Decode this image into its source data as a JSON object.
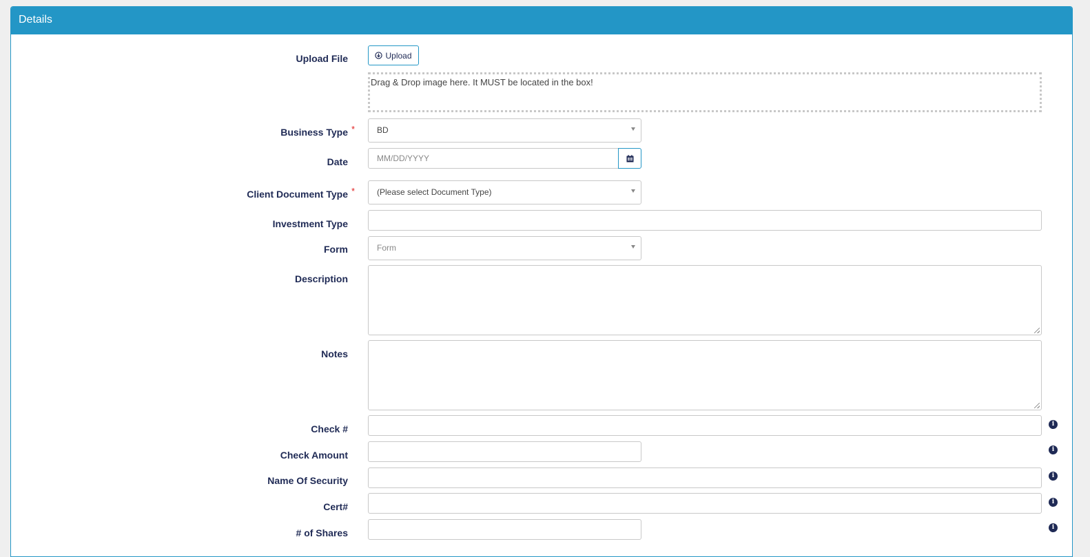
{
  "panel": {
    "title": "Details"
  },
  "upload": {
    "label": "Upload File",
    "button_label": "Upload",
    "dropzone_text": "Drag & Drop image here. It MUST be located in the box!"
  },
  "business_type": {
    "label": "Business Type",
    "required_mark": "*",
    "value": "BD"
  },
  "date": {
    "label": "Date",
    "placeholder": "MM/DD/YYYY"
  },
  "client_document_type": {
    "label": "Client Document Type",
    "required_mark": "*",
    "value": "(Please select Document Type)"
  },
  "investment_type": {
    "label": "Investment Type",
    "value": ""
  },
  "form": {
    "label": "Form",
    "placeholder": "Form"
  },
  "description": {
    "label": "Description",
    "value": ""
  },
  "notes": {
    "label": "Notes",
    "value": ""
  },
  "check_number": {
    "label": "Check #",
    "value": ""
  },
  "check_amount": {
    "label": "Check Amount",
    "value": ""
  },
  "name_of_security": {
    "label": "Name Of Security",
    "value": ""
  },
  "cert_number": {
    "label": "Cert#",
    "value": ""
  },
  "num_shares": {
    "label": "# of Shares",
    "value": ""
  },
  "icons": {
    "upload": "download-circle-icon",
    "calendar": "calendar-icon",
    "info": "info-icon",
    "info_glyph": "i"
  },
  "colors": {
    "header": "#2396c6",
    "label": "#1f2a55",
    "required": "#e02020"
  }
}
